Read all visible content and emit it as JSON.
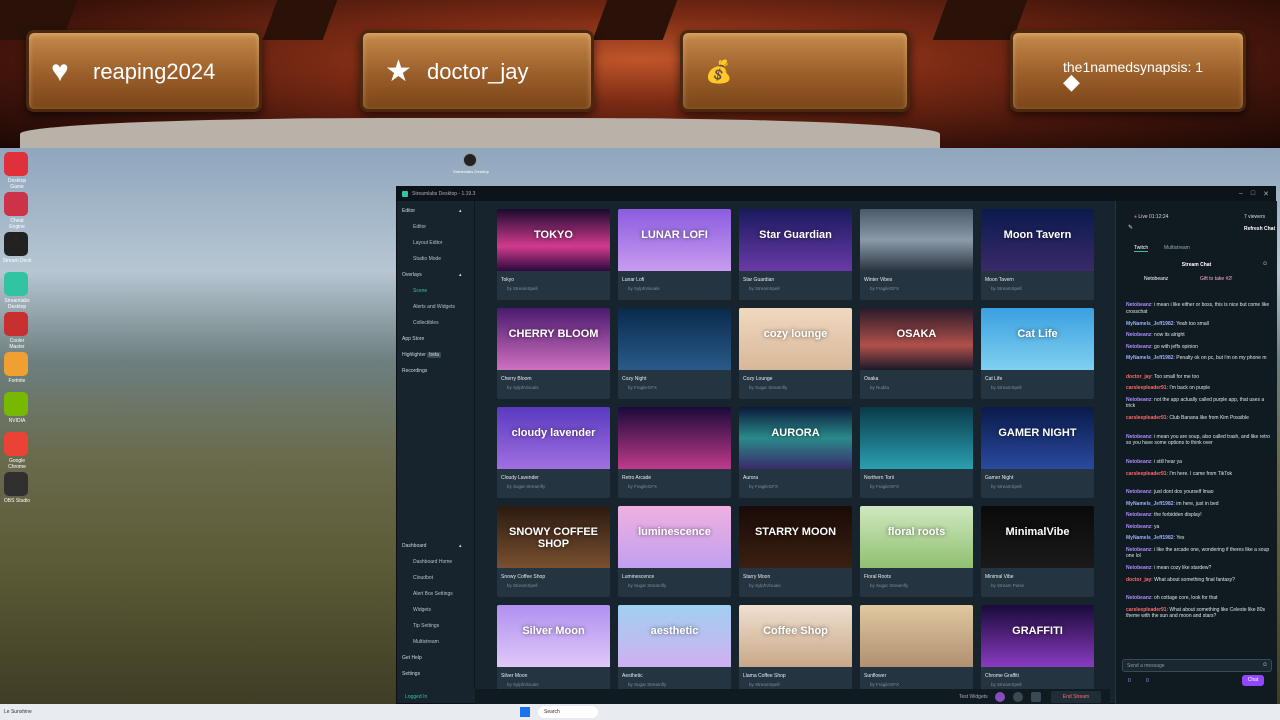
{
  "overlay": {
    "plaques": [
      {
        "icon": "heart-icon",
        "glyph": "♥",
        "label": "reaping2024"
      },
      {
        "icon": "star-icon",
        "glyph": "★",
        "label": "doctor_jay"
      },
      {
        "icon": "money-bag-icon",
        "glyph": "💰",
        "label": ""
      },
      {
        "icon": "diamond-icon",
        "glyph": "◆",
        "label": "the1namedsynapsis: 1"
      }
    ]
  },
  "desktop": {
    "icons": [
      {
        "label": "Desktop Game",
        "color": "#e0303a"
      },
      {
        "label": "Cheat Engine",
        "color": "#cc3348"
      },
      {
        "label": "Stream Deck",
        "color": "#222"
      },
      {
        "label": "Streamlabs Desktop",
        "color": "#31c3a2"
      },
      {
        "label": "Cooler Master",
        "color": "#c83030"
      },
      {
        "label": "Fortnite",
        "color": "#f0a030"
      },
      {
        "label": "NVIDIA",
        "color": "#76b900"
      },
      {
        "label": "Google Chrome",
        "color": "#ea4335"
      },
      {
        "label": "OBS Studio",
        "color": "#303030"
      }
    ],
    "top_icon_label": "Streamlabs Desktop"
  },
  "app": {
    "title": "Streamlabs Desktop - 1.19.3",
    "nav": {
      "editor": "Editor",
      "editor_items": [
        "Editor",
        "Layout Editor",
        "Studio Mode"
      ],
      "overlays": "Overlays",
      "overlay_items": [
        "Scene",
        "Alerts and Widgets",
        "Collectibles"
      ],
      "app_store": "App Store",
      "highlighter": "Highlighter",
      "highlighter_badge": "beta",
      "recordings": "Recordings",
      "dashboard": "Dashboard",
      "dashboard_items": [
        "Dashboard Home",
        "Cloudbot",
        "Alert Box Settings",
        "Widgets",
        "Tip Settings",
        "Multistream"
      ],
      "get_help": "Get Help",
      "settings": "Settings",
      "logged_in": "Logged In"
    },
    "themes": [
      {
        "name": "Tokyo",
        "by": "by StreamSpell",
        "art": "TOKYO",
        "bg": "linear-gradient(#1a0a2e,#d23a8e 60%,#2a0a3e)"
      },
      {
        "name": "Lunar Lofi",
        "by": "by SylphVisuals",
        "art": "LUNAR LOFI",
        "bg": "linear-gradient(#8a5ce0,#c89cf0)"
      },
      {
        "name": "Star Guardian",
        "by": "by StreamSpell",
        "art": "Star Guardian",
        "bg": "linear-gradient(#1a1a5e,#6a3aa8)"
      },
      {
        "name": "Winter Vibes",
        "by": "by FragileGFX",
        "art": "",
        "bg": "linear-gradient(#4a5a6a,#8a9aa8 50%,#2a3440)"
      },
      {
        "name": "Moon Tavern",
        "by": "by StreamSpell",
        "art": "Moon Tavern",
        "bg": "linear-gradient(#0a1a4e,#3a2a6a)"
      },
      {
        "name": "Cherry Bloom",
        "by": "by SylphVisuals",
        "art": "CHERRY BLOOM",
        "bg": "linear-gradient(#4a1a6e,#d070c0)"
      },
      {
        "name": "Cozy Night",
        "by": "by FragileGFX",
        "art": "",
        "bg": "linear-gradient(#0a2a4a,#2a5a8a)"
      },
      {
        "name": "Cozy Lounge",
        "by": "by Sugar Streamfly",
        "art": "cozy lounge",
        "bg": "linear-gradient(#f0d8c0,#d8b898)"
      },
      {
        "name": "Osaka",
        "by": "by Nudita",
        "art": "OSAKA",
        "bg": "linear-gradient(#2a1a2a,#b0504a 60%,#1a1a2a)"
      },
      {
        "name": "Cat Life",
        "by": "by StreamSpell",
        "art": "Cat Life",
        "bg": "linear-gradient(#3aa0e0,#80d0f0)"
      },
      {
        "name": "Cloudy Lavender",
        "by": "by Sugar Streamfly",
        "art": "cloudy lavender",
        "bg": "linear-gradient(#5a3ac0,#a070e0)"
      },
      {
        "name": "Retro Arcade",
        "by": "by FragileGFX",
        "art": "",
        "bg": "linear-gradient(#1a0a3a,#c03a8a)"
      },
      {
        "name": "Aurora",
        "by": "by FragileGFX",
        "art": "AURORA",
        "bg": "linear-gradient(#0a1a3a,#2a8a8a 50%,#3a2a6a)"
      },
      {
        "name": "Northern Torii",
        "by": "by FragileGFX",
        "art": "",
        "bg": "linear-gradient(#0a3a4a,#2aa0b0)"
      },
      {
        "name": "Gamer Night",
        "by": "by StreamSpell",
        "art": "GAMER NIGHT",
        "bg": "linear-gradient(#0a1a4a,#2a4aa0)"
      },
      {
        "name": "Snowy Coffee Shop",
        "by": "by StreamSpell",
        "art": "SNOWY COFFEE SHOP",
        "bg": "linear-gradient(#2a1a10,#7a5030)"
      },
      {
        "name": "Luminescence",
        "by": "by Sugar Streamfly",
        "art": "luminescence",
        "bg": "linear-gradient(#f0b0e0,#c0a0f0)"
      },
      {
        "name": "Starry Moon",
        "by": "by SylphVisuals",
        "art": "STARRY MOON",
        "bg": "linear-gradient(#1a0a08,#3a2010)"
      },
      {
        "name": "Floral Roots",
        "by": "by Sugar Streamfly",
        "art": "floral roots",
        "bg": "linear-gradient(#d0e8c0,#90c070)"
      },
      {
        "name": "Minimal Vibe",
        "by": "by Stream Pulse",
        "art": "MinimalVibe",
        "bg": "linear-gradient(#0a0a0a,#1a1a1a)"
      },
      {
        "name": "Silver Moon",
        "by": "by SylphVisuals",
        "art": "Silver Moon",
        "bg": "linear-gradient(#b090f0,#e0c8f8)"
      },
      {
        "name": "Aesthetic",
        "by": "by Sugar Streamfly",
        "art": "aesthetic",
        "bg": "linear-gradient(#a0d0f0,#d0b0f0)"
      },
      {
        "name": "Llama Coffee Shop",
        "by": "by StreamSpell",
        "art": "Coffee Shop",
        "bg": "linear-gradient(#f0e0d0,#c8a888)"
      },
      {
        "name": "Sunflower",
        "by": "by FragileGFX",
        "art": "",
        "bg": "linear-gradient(#e0c8a0,#b09070)"
      },
      {
        "name": "Chrome Graffiti",
        "by": "by StreamSpell",
        "art": "GRAFFITI",
        "bg": "linear-gradient(#1a0a3a,#8a3ac0)"
      }
    ],
    "bottom": {
      "test_widgets": "Test Widgets",
      "end_stream": "End Stream"
    },
    "chat": {
      "live": "Live 01:12:24",
      "viewers": "7 viewers",
      "refresh": "Refresh Chat",
      "tabs": [
        "Twitch",
        "Multistream"
      ],
      "header": "Stream Chat",
      "gift_user": "Netobeanz",
      "gift_text": "Gift to take #2!",
      "messages": [
        {
          "user": "Netobeanz",
          "text": ": i mean i like either or boss, this is nice but come like crosschat",
          "style": "b3"
        },
        {
          "user": "MyNamels_Jeff1982",
          "text": ": Yeah too small",
          "style": "b1"
        },
        {
          "user": "Netobeanz",
          "text": ": now its alright",
          "style": "b3"
        },
        {
          "user": "Netobeanz",
          "text": ": go with jeffs opinion",
          "style": "b3"
        },
        {
          "user": "MyNamels_Jeff1982",
          "text": ": Penalty ok on pc, but i'm on my phone m",
          "style": "b1"
        },
        {
          "user": "doctor_jay",
          "text": ": Too small for me too",
          "style": "b2"
        },
        {
          "user": "carsleepleader91",
          "text": ": I'm back on purple",
          "style": "b2"
        },
        {
          "user": "Netobeanz",
          "text": ": not the app actually called purple app, that uses a trick",
          "style": "b3"
        },
        {
          "user": "carsleepleader91",
          "text": ": Club Banana like from Kim Possible",
          "style": "b2"
        },
        {
          "user": "Netobeanz",
          "text": ": i mean you are soup, also called trash, and like retro so you have some options to think over",
          "style": "b3"
        },
        {
          "user": "Netobeanz",
          "text": ": i still hear ya",
          "style": "b3"
        },
        {
          "user": "carsleepleader91",
          "text": ": I'm here. I came from TikTok",
          "style": "b2"
        },
        {
          "user": "Netobeanz",
          "text": ": just dont dox yourself lmao",
          "style": "b3"
        },
        {
          "user": "MyNamels_Jeff1982",
          "text": ": im here, just in bed",
          "style": "b1"
        },
        {
          "user": "Netobeanz",
          "text": ": the forbidden display!",
          "style": "b3"
        },
        {
          "user": "Netobeanz",
          "text": ": ya",
          "style": "b3"
        },
        {
          "user": "MyNamels_Jeff1982",
          "text": ": Yes",
          "style": "b1"
        },
        {
          "user": "Netobeanz",
          "text": ": i like the arcade one, wondering if theres like a soup one lol",
          "style": "b3"
        },
        {
          "user": "Netobeanz",
          "text": ": i mean cozy like stardew?",
          "style": "b3"
        },
        {
          "user": "doctor_jay",
          "text": ": What about something final fantasy?",
          "style": "b2"
        },
        {
          "user": "Netobeanz",
          "text": ": oh cottage core, look for that",
          "style": "b3"
        },
        {
          "user": "carsleepleader91",
          "text": ": What about something like Celeste like 80s theme with the sun and moon and stars?",
          "style": "b2"
        }
      ],
      "input_placeholder": "Send a message",
      "chat_button": "Chat",
      "points": "0",
      "bits": "0"
    }
  },
  "taskbar": {
    "left_text": "Le Sunshine",
    "search": "Search"
  }
}
